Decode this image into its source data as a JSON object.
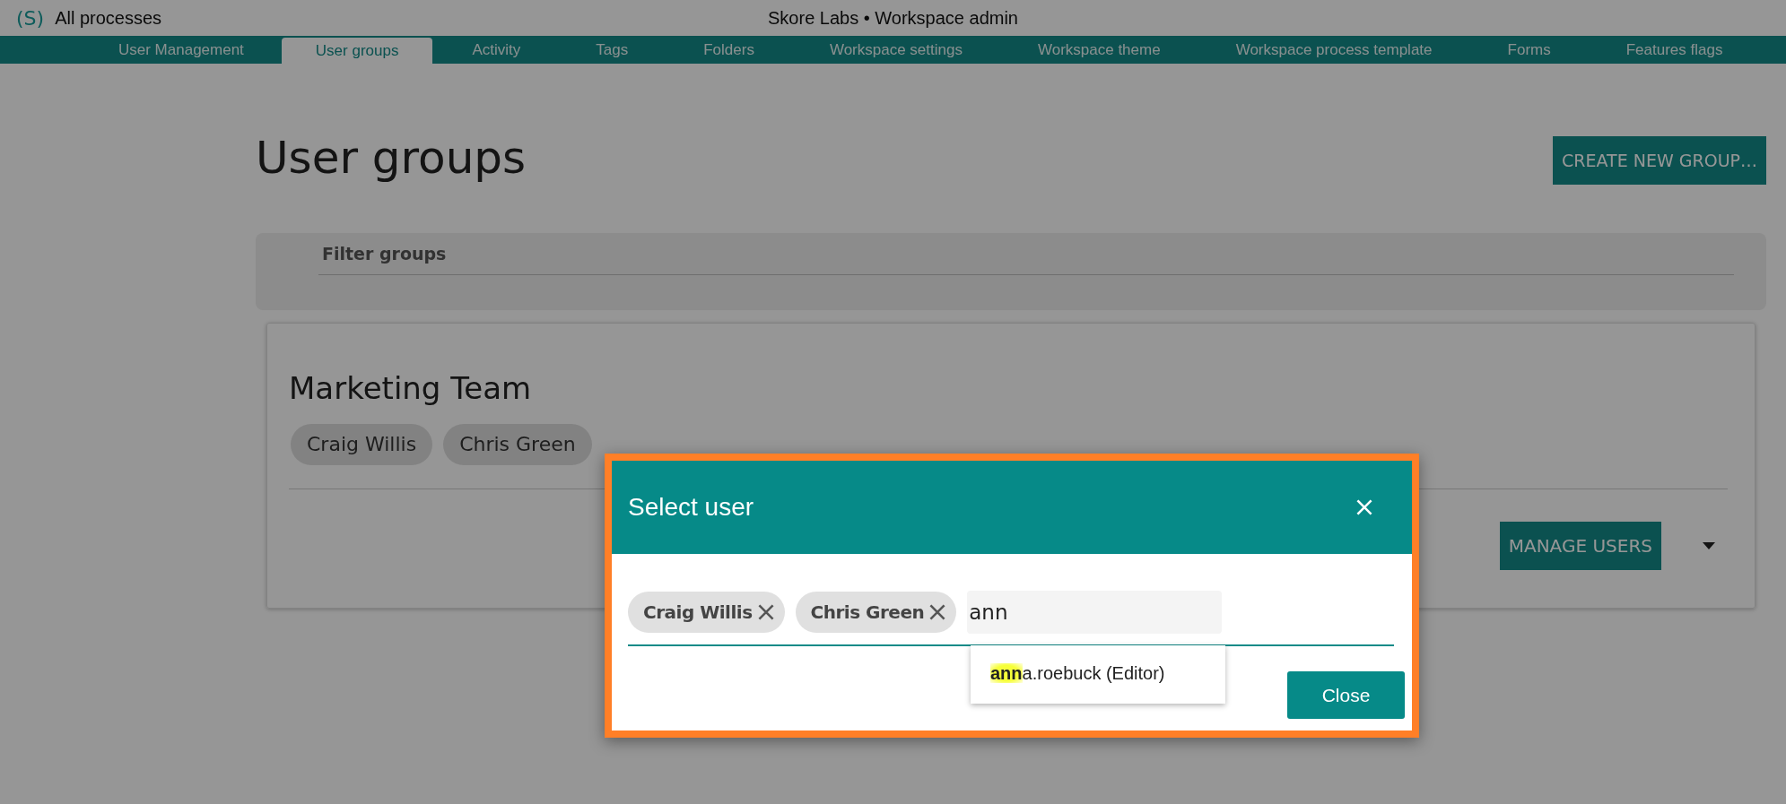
{
  "app": {
    "logo": "(S)",
    "link": "All processes",
    "title": "Skore Labs • Workspace admin"
  },
  "tabs": [
    {
      "label": "User Management",
      "selected": false
    },
    {
      "label": "User groups",
      "selected": true
    },
    {
      "label": "Activity",
      "selected": false
    },
    {
      "label": "Tags",
      "selected": false
    },
    {
      "label": "Folders",
      "selected": false
    },
    {
      "label": "Workspace settings",
      "selected": false
    },
    {
      "label": "Workspace theme",
      "selected": false
    },
    {
      "label": "Workspace process template",
      "selected": false
    },
    {
      "label": "Forms",
      "selected": false
    },
    {
      "label": "Features flags",
      "selected": false
    }
  ],
  "page": {
    "heading": "User groups",
    "create_button": "CREATE NEW GROUP…"
  },
  "filter": {
    "placeholder": "Filter groups"
  },
  "groups": [
    {
      "name": "Marketing Team",
      "members": [
        "Craig Willis",
        "Chris Green"
      ],
      "manage_button": "MANAGE USERS"
    }
  ],
  "dialog": {
    "title": "Select user",
    "selected_users": [
      "Craig Willis",
      "Chris Green"
    ],
    "query": "ann",
    "suggestions": [
      "**ann**a.roebuck (Editor)"
    ],
    "close_button": "Close"
  }
}
